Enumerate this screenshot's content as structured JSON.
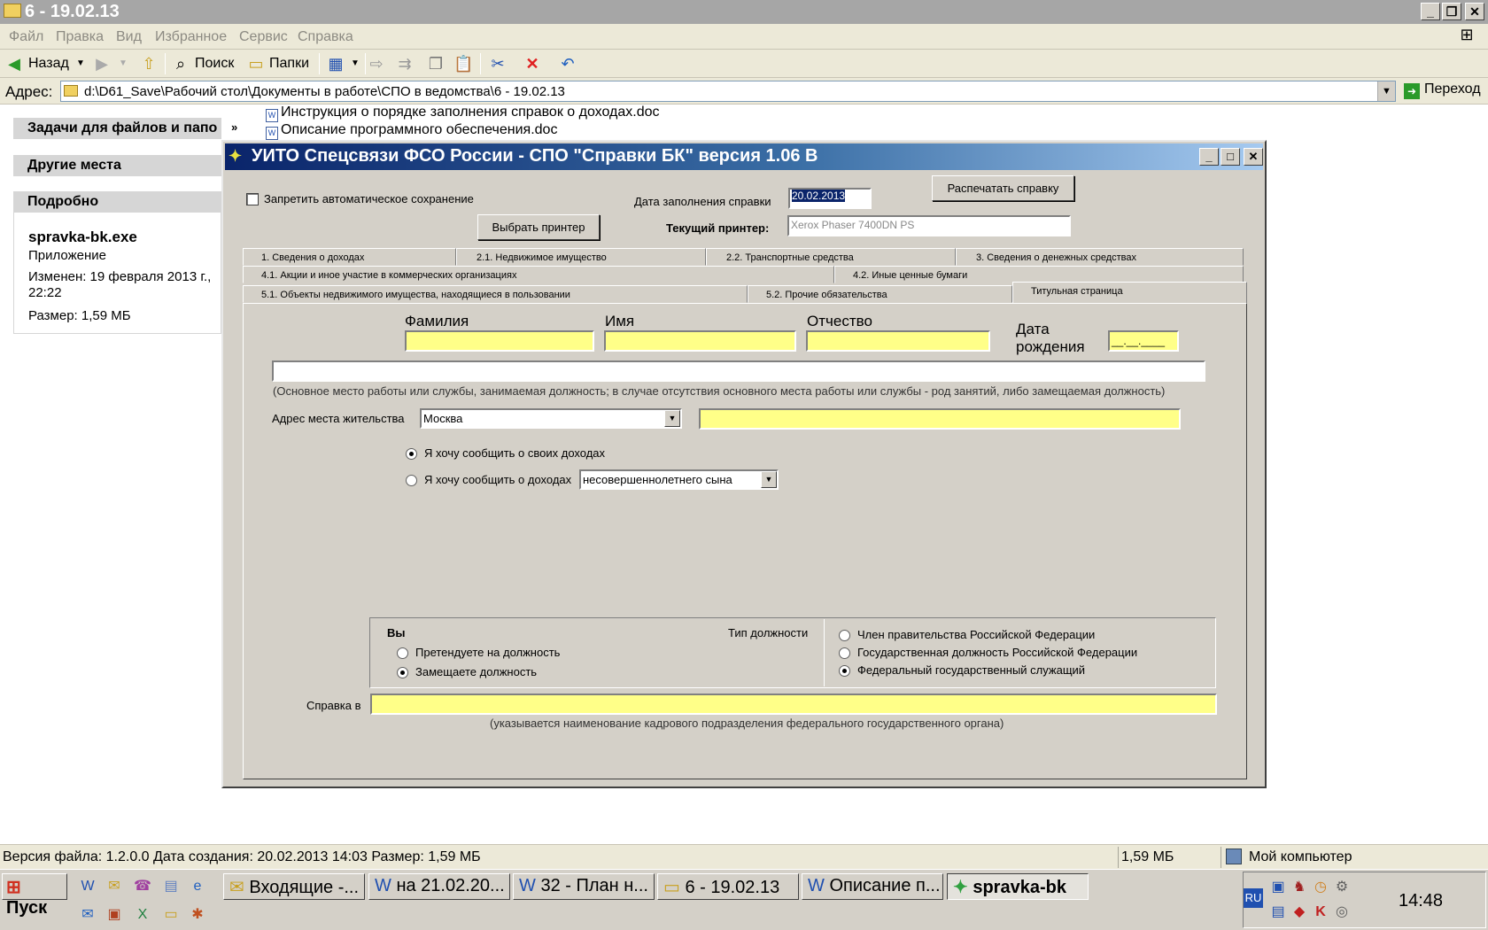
{
  "explorer": {
    "title": "6 - 19.02.13",
    "menu": [
      "Файл",
      "Правка",
      "Вид",
      "Избранное",
      "Сервис",
      "Справка"
    ],
    "toolbar": {
      "back": "Назад",
      "search": "Поиск",
      "folders": "Папки"
    },
    "address_label": "Адрес:",
    "address_value": "d:\\D61_Save\\Рабочий стол\\Документы в работе\\СПО в ведомства\\6 - 19.02.13",
    "go": "Переход"
  },
  "left_pane": {
    "tasks": "Задачи для файлов и папо",
    "other_places": "Другие места",
    "details": "Подробно",
    "file_name": "spravka-bk.exe",
    "file_type": "Приложение",
    "modified": "Изменен: 19 февраля 2013 г., 22:22",
    "size": "Размер: 1,59 МБ"
  },
  "files": [
    "Инструкция о порядке заполнения справок о доходах.doc",
    "Описание программного обеспечения.doc"
  ],
  "app": {
    "title": "УИТО Спецсвязи ФСО России - СПО \"Справки БК\" версия 1.06 В",
    "no_autosave_label": "Запретить автоматическое сохранение",
    "fill_date_label": "Дата заполнения справки",
    "fill_date_value": "20.02.2013",
    "print_button": "Распечатать справку",
    "choose_printer_button": "Выбрать принтер",
    "current_printer_label": "Текущий принтер:",
    "current_printer_value": "Xerox Phaser 7400DN PS",
    "tabs_row1": [
      "1. Сведения о доходах",
      "2.1. Недвижимое имущество",
      "2.2. Транспортные средства",
      "3. Сведения о денежных средствах"
    ],
    "tabs_row2": [
      "4.1. Акции и иное участие в коммерческих организациях",
      "4.2. Иные ценные бумаги"
    ],
    "tabs_row3": [
      "5.1. Объекты недвижимого имущества, находящиеся в пользовании",
      "5.2. Прочие обязательства",
      "Титульная страница"
    ],
    "surname_label": "Фамилия",
    "name_label": "Имя",
    "patronymic_label": "Отчество",
    "birth_label_1": "Дата",
    "birth_label_2": "рождения",
    "birth_value": "__.__.____",
    "work_hint": "(Основное место работы или службы, занимаемая должность; в случае отсутствия основного места работы или службы - род занятий, либо замещаемая должность)",
    "address_label": "Адрес места жительства",
    "address_city": "Москва",
    "radio_own": "Я хочу сообщить о своих доходах",
    "radio_relative": "Я хочу сообщить о доходах",
    "relative_value": "несовершеннолетнего сына",
    "you_label": "Вы",
    "position_type_label": "Тип должности",
    "radio_apply": "Претендуете на должность",
    "radio_hold": "Замещаете должность",
    "radio_gov_member": "Член правительства Российской Федерации",
    "radio_state_pos": "Государственная должность Российской Федерации",
    "radio_fed_servant": "Федеральный государственный служащий",
    "spravka_label": "Справка в",
    "spravka_hint": "(указывается наименование кадрового подразделения федерального государственного органа)"
  },
  "statusbar": {
    "info": "Версия файла: 1.2.0.0 Дата создания: 20.02.2013 14:03 Размер: 1,59 МБ",
    "size": "1,59 МБ",
    "location": "Мой компьютер"
  },
  "taskbar": {
    "start": "Пуск",
    "tasks": [
      "Входящие -...",
      "на 21.02.20...",
      "32 - План н...",
      "6 - 19.02.13",
      "Описание п...",
      "spravka-bk"
    ],
    "lang": "RU",
    "clock": "14:48"
  }
}
